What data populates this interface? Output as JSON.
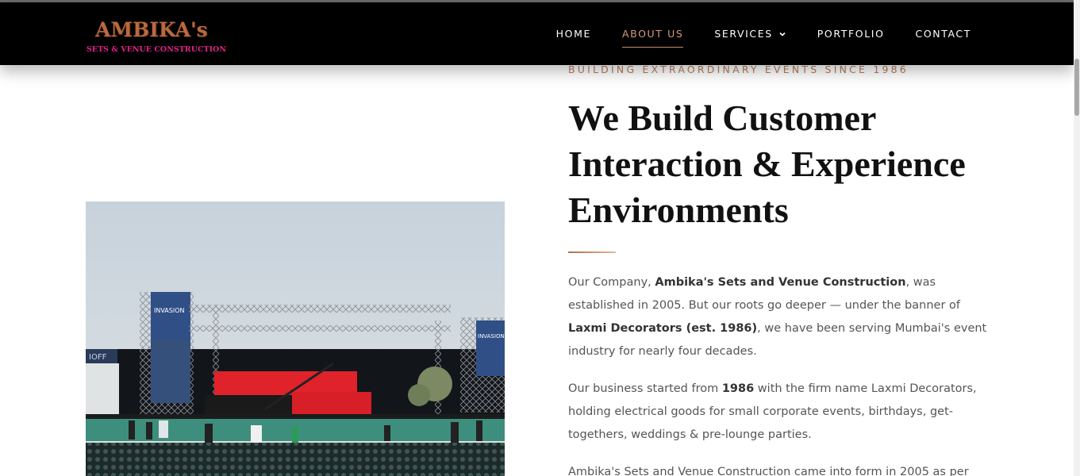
{
  "brand": {
    "logo_text": "AMBIKA's",
    "logo_tagline": "SETS & VENUE CONSTRUCTION",
    "primary_color": "#000000",
    "accent_color": "#b97a5a",
    "tagline_color": "#e0208a"
  },
  "nav": {
    "items": [
      {
        "label": "HOME",
        "active": false
      },
      {
        "label": "ABOUT US",
        "active": true
      },
      {
        "label": "SERVICES",
        "active": false,
        "icon": "chevron-down-icon"
      },
      {
        "label": "PORTFOLIO",
        "active": false
      },
      {
        "label": "CONTACT",
        "active": false
      }
    ]
  },
  "about": {
    "eyebrow": "BUILDING EXTRAORDINARY EVENTS SINCE 1986",
    "headline": "We Build Customer Interaction & Experience Environments",
    "p1": {
      "t1": "Our Company, ",
      "b1": "Ambika's Sets and Venue Construction",
      "t2": ", was established in 2005. But our roots go deeper — under the banner of ",
      "b2": "Laxmi Decorators (est. 1986)",
      "t3": ", we have been serving Mumbai's event industry for nearly four decades."
    },
    "p2": {
      "t1": "Our business started from ",
      "b1": "1986",
      "t2": " with the firm name Laxmi Decorators, holding electrical goods for small corporate events, birthdays, get-togethers, weddings & pre-lounge parties."
    },
    "p3": {
      "t1": "Ambika's Sets and Venue Construction came into form in 2005 as per"
    }
  },
  "photo": {
    "banner_left": "INVASION",
    "banner_right": "INVASION",
    "side_sign": "IOFF"
  }
}
